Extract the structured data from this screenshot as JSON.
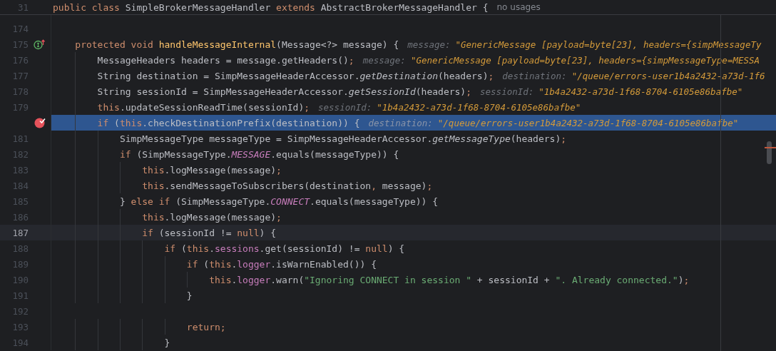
{
  "sticky_header": {
    "line_number": "31",
    "tokens": [
      {
        "kind": "keyword",
        "text": "public class "
      },
      {
        "kind": "plain",
        "text": "SimpleBrokerMessageHandler "
      },
      {
        "kind": "keyword",
        "text": "extends "
      },
      {
        "kind": "plain",
        "text": "AbstractBrokerMessageHandler {"
      }
    ],
    "usage_hint": "no usages"
  },
  "lines": [
    {
      "number": "174",
      "selected": false,
      "current": false,
      "breakpoint": false,
      "override_marker": false
    },
    {
      "number": "175",
      "tokens": [
        {
          "kind": "keyword",
          "text": "    protected void "
        },
        {
          "kind": "declaration",
          "text": "handleMessageInternal"
        },
        {
          "kind": "plain",
          "text": "(Message<?> message) {"
        }
      ],
      "hint": {
        "label": "message:",
        "value": "\"GenericMessage [payload=byte[23], headers={simpMessageTy"
      },
      "selected": false,
      "current": false,
      "breakpoint": false,
      "override_marker": true
    },
    {
      "number": "176",
      "tokens": [
        {
          "kind": "plain",
          "text": "        MessageHeaders headers = message.getHeaders()"
        },
        {
          "kind": "punct",
          "text": ";"
        }
      ],
      "hint": {
        "label": "message:",
        "value": "\"GenericMessage [payload=byte[23], headers={simpMessageType=MESSA"
      },
      "selected": false,
      "current": false,
      "breakpoint": false,
      "override_marker": false
    },
    {
      "number": "177",
      "tokens": [
        {
          "kind": "plain",
          "text": "        String destination = SimpMessageHeaderAccessor."
        },
        {
          "kind": "static",
          "text": "getDestination"
        },
        {
          "kind": "plain",
          "text": "(headers)"
        },
        {
          "kind": "punct",
          "text": ";"
        }
      ],
      "hint": {
        "label": "destination:",
        "value": "\"/queue/errors-user1b4a2432-a73d-1f6"
      },
      "selected": false,
      "current": false,
      "breakpoint": false,
      "override_marker": false
    },
    {
      "number": "178",
      "tokens": [
        {
          "kind": "plain",
          "text": "        String sessionId = SimpMessageHeaderAccessor."
        },
        {
          "kind": "static",
          "text": "getSessionId"
        },
        {
          "kind": "plain",
          "text": "(headers)"
        },
        {
          "kind": "punct",
          "text": ";"
        }
      ],
      "hint": {
        "label": "sessionId:",
        "value": "\"1b4a2432-a73d-1f68-8704-6105e86bafbe\""
      },
      "selected": false,
      "current": false,
      "breakpoint": false,
      "override_marker": false
    },
    {
      "number": "179",
      "tokens": [
        {
          "kind": "keyword",
          "text": "        this"
        },
        {
          "kind": "plain",
          "text": ".updateSessionReadTime(sessionId)"
        },
        {
          "kind": "punct",
          "text": ";"
        }
      ],
      "hint": {
        "label": "sessionId:",
        "value": "\"1b4a2432-a73d-1f68-8704-6105e86bafbe\""
      },
      "selected": false,
      "current": false,
      "breakpoint": false,
      "override_marker": false
    },
    {
      "tokens": [
        {
          "kind": "keyword",
          "text": "        if"
        },
        {
          "kind": "plain",
          "text": " ("
        },
        {
          "kind": "keyword",
          "text": "this"
        },
        {
          "kind": "plain",
          "text": ".checkDestinationPrefix(destination)) {"
        }
      ],
      "hint": {
        "label": "destination:",
        "value": "\"/queue/errors-user1b4a2432-a73d-1f68-8704-6105e86bafbe\""
      },
      "selected": true,
      "current": false,
      "breakpoint": true,
      "override_marker": false
    },
    {
      "number": "181",
      "tokens": [
        {
          "kind": "plain",
          "text": "            SimpMessageType messageType = SimpMessageHeaderAccessor."
        },
        {
          "kind": "static",
          "text": "getMessageType"
        },
        {
          "kind": "plain",
          "text": "(headers)"
        },
        {
          "kind": "punct",
          "text": ";"
        }
      ],
      "selected": false,
      "current": false,
      "breakpoint": false,
      "override_marker": false
    },
    {
      "number": "182",
      "tokens": [
        {
          "kind": "keyword",
          "text": "            if"
        },
        {
          "kind": "plain",
          "text": " (SimpMessageType."
        },
        {
          "kind": "constant",
          "text": "MESSAGE"
        },
        {
          "kind": "plain",
          "text": ".equals(messageType)) {"
        }
      ],
      "selected": false,
      "current": false,
      "breakpoint": false,
      "override_marker": false
    },
    {
      "number": "183",
      "tokens": [
        {
          "kind": "keyword",
          "text": "                this"
        },
        {
          "kind": "plain",
          "text": ".logMessage(message)"
        },
        {
          "kind": "punct",
          "text": ";"
        }
      ],
      "selected": false,
      "current": false,
      "breakpoint": false,
      "override_marker": false
    },
    {
      "number": "184",
      "tokens": [
        {
          "kind": "keyword",
          "text": "                this"
        },
        {
          "kind": "plain",
          "text": ".sendMessageToSubscribers(destination"
        },
        {
          "kind": "punct",
          "text": ","
        },
        {
          "kind": "plain",
          "text": " message)"
        },
        {
          "kind": "punct",
          "text": ";"
        }
      ],
      "selected": false,
      "current": false,
      "breakpoint": false,
      "override_marker": false
    },
    {
      "number": "185",
      "tokens": [
        {
          "kind": "plain",
          "text": "            } "
        },
        {
          "kind": "keyword",
          "text": "else if"
        },
        {
          "kind": "plain",
          "text": " (SimpMessageType."
        },
        {
          "kind": "constant",
          "text": "CONNECT"
        },
        {
          "kind": "plain",
          "text": ".equals(messageType)) {"
        }
      ],
      "selected": false,
      "current": false,
      "breakpoint": false,
      "override_marker": false
    },
    {
      "number": "186",
      "tokens": [
        {
          "kind": "keyword",
          "text": "                this"
        },
        {
          "kind": "plain",
          "text": ".logMessage(message)"
        },
        {
          "kind": "punct",
          "text": ";"
        }
      ],
      "selected": false,
      "current": false,
      "breakpoint": false,
      "override_marker": false
    },
    {
      "number": "187",
      "tokens": [
        {
          "kind": "keyword",
          "text": "                if"
        },
        {
          "kind": "plain",
          "text": " (sessionId != "
        },
        {
          "kind": "keyword",
          "text": "null"
        },
        {
          "kind": "plain",
          "text": ") {"
        }
      ],
      "selected": false,
      "current": true,
      "breakpoint": false,
      "override_marker": false
    },
    {
      "number": "188",
      "tokens": [
        {
          "kind": "keyword",
          "text": "                    if"
        },
        {
          "kind": "plain",
          "text": " ("
        },
        {
          "kind": "keyword",
          "text": "this"
        },
        {
          "kind": "plain",
          "text": "."
        },
        {
          "kind": "field",
          "text": "sessions"
        },
        {
          "kind": "plain",
          "text": ".get(sessionId) != "
        },
        {
          "kind": "keyword",
          "text": "null"
        },
        {
          "kind": "plain",
          "text": ") {"
        }
      ],
      "selected": false,
      "current": false,
      "breakpoint": false,
      "override_marker": false
    },
    {
      "number": "189",
      "tokens": [
        {
          "kind": "keyword",
          "text": "                        if"
        },
        {
          "kind": "plain",
          "text": " ("
        },
        {
          "kind": "keyword",
          "text": "this"
        },
        {
          "kind": "plain",
          "text": "."
        },
        {
          "kind": "field",
          "text": "logger"
        },
        {
          "kind": "plain",
          "text": ".isWarnEnabled()) {"
        }
      ],
      "selected": false,
      "current": false,
      "breakpoint": false,
      "override_marker": false
    },
    {
      "number": "190",
      "tokens": [
        {
          "kind": "keyword",
          "text": "                            this"
        },
        {
          "kind": "plain",
          "text": "."
        },
        {
          "kind": "field",
          "text": "logger"
        },
        {
          "kind": "plain",
          "text": ".warn("
        },
        {
          "kind": "string",
          "text": "\"Ignoring CONNECT in session \""
        },
        {
          "kind": "plain",
          "text": " + sessionId + "
        },
        {
          "kind": "string",
          "text": "\". Already connected.\""
        },
        {
          "kind": "plain",
          "text": ")"
        },
        {
          "kind": "punct",
          "text": ";"
        }
      ],
      "selected": false,
      "current": false,
      "breakpoint": false,
      "override_marker": false
    },
    {
      "number": "191",
      "tokens": [
        {
          "kind": "plain",
          "text": "                        }"
        }
      ],
      "selected": false,
      "current": false,
      "breakpoint": false,
      "override_marker": false
    },
    {
      "number": "192",
      "selected": false,
      "current": false,
      "breakpoint": false,
      "override_marker": false
    },
    {
      "number": "193",
      "tokens": [
        {
          "kind": "keyword",
          "text": "                        return"
        },
        {
          "kind": "punct",
          "text": ";"
        }
      ],
      "selected": false,
      "current": false,
      "breakpoint": false,
      "override_marker": false
    },
    {
      "number": "194",
      "tokens": [
        {
          "kind": "plain",
          "text": "                    }"
        }
      ],
      "selected": false,
      "current": false,
      "breakpoint": false,
      "override_marker": false
    }
  ]
}
